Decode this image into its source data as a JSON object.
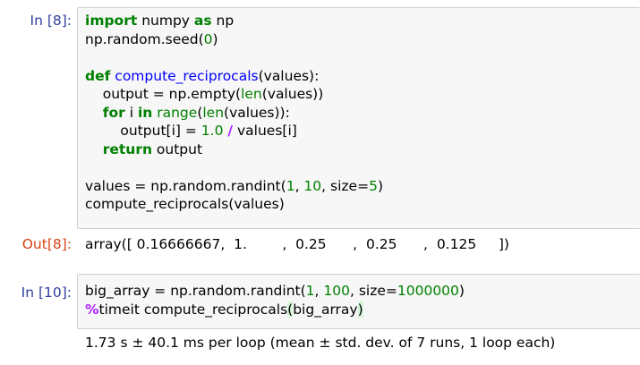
{
  "cells": [
    {
      "in_prompt": "In [8]:",
      "code": {
        "l1": {
          "a": "import",
          "b": " numpy ",
          "c": "as",
          "d": " np"
        },
        "l2": {
          "a": "np.random.seed(",
          "b": "0",
          "c": ")"
        },
        "l4": {
          "a": "def",
          "b": " ",
          "c": "compute_reciprocals",
          "d": "(values):"
        },
        "l5": {
          "a": "    output = np.empty(",
          "b": "len",
          "c": "(values))"
        },
        "l6": {
          "a": "    ",
          "b": "for",
          "c": " i ",
          "d": "in",
          "e": " ",
          "f": "range",
          "g": "(",
          "h": "len",
          "i": "(values)):"
        },
        "l7": {
          "a": "        output[i] = ",
          "b": "1.0",
          "c": " ",
          "d": "/",
          "e": " values[i]"
        },
        "l8": {
          "a": "    ",
          "b": "return",
          "c": " output"
        },
        "l10": {
          "a": "values = np.random.randint(",
          "b": "1",
          "c": ", ",
          "d": "10",
          "e": ", size=",
          "f": "5",
          "g": ")"
        },
        "l11": {
          "a": "compute_reciprocals(values)"
        }
      },
      "out_prompt": "Out[8]:",
      "output": "array([ 0.16666667,  1.        ,  0.25      ,  0.25      ,  0.125     ])"
    },
    {
      "in_prompt": "In [10]:",
      "code": {
        "l1": {
          "a": "big_array = np.random.randint(",
          "b": "1",
          "c": ", ",
          "d": "100",
          "e": ", size=",
          "f": "1000000",
          "g": ")"
        },
        "l2": {
          "a": "%",
          "b": "timeit compute_reciprocals",
          "c": "(",
          "d": "big_array",
          "e": ")"
        }
      },
      "output": "1.73 s ± 40.1 ms per loop (mean ± std. dev. of 7 runs, 1 loop each)"
    }
  ],
  "colors": {
    "in_prompt": "#303f9f",
    "out_prompt": "#d84315",
    "keyword": "#008000",
    "function_name": "#0000ff",
    "number": "#008000",
    "operator": "#aa22ff",
    "input_background": "#f7f7f7",
    "input_border": "#cfcfcf",
    "bracket_highlight": "#d6f5d6"
  }
}
